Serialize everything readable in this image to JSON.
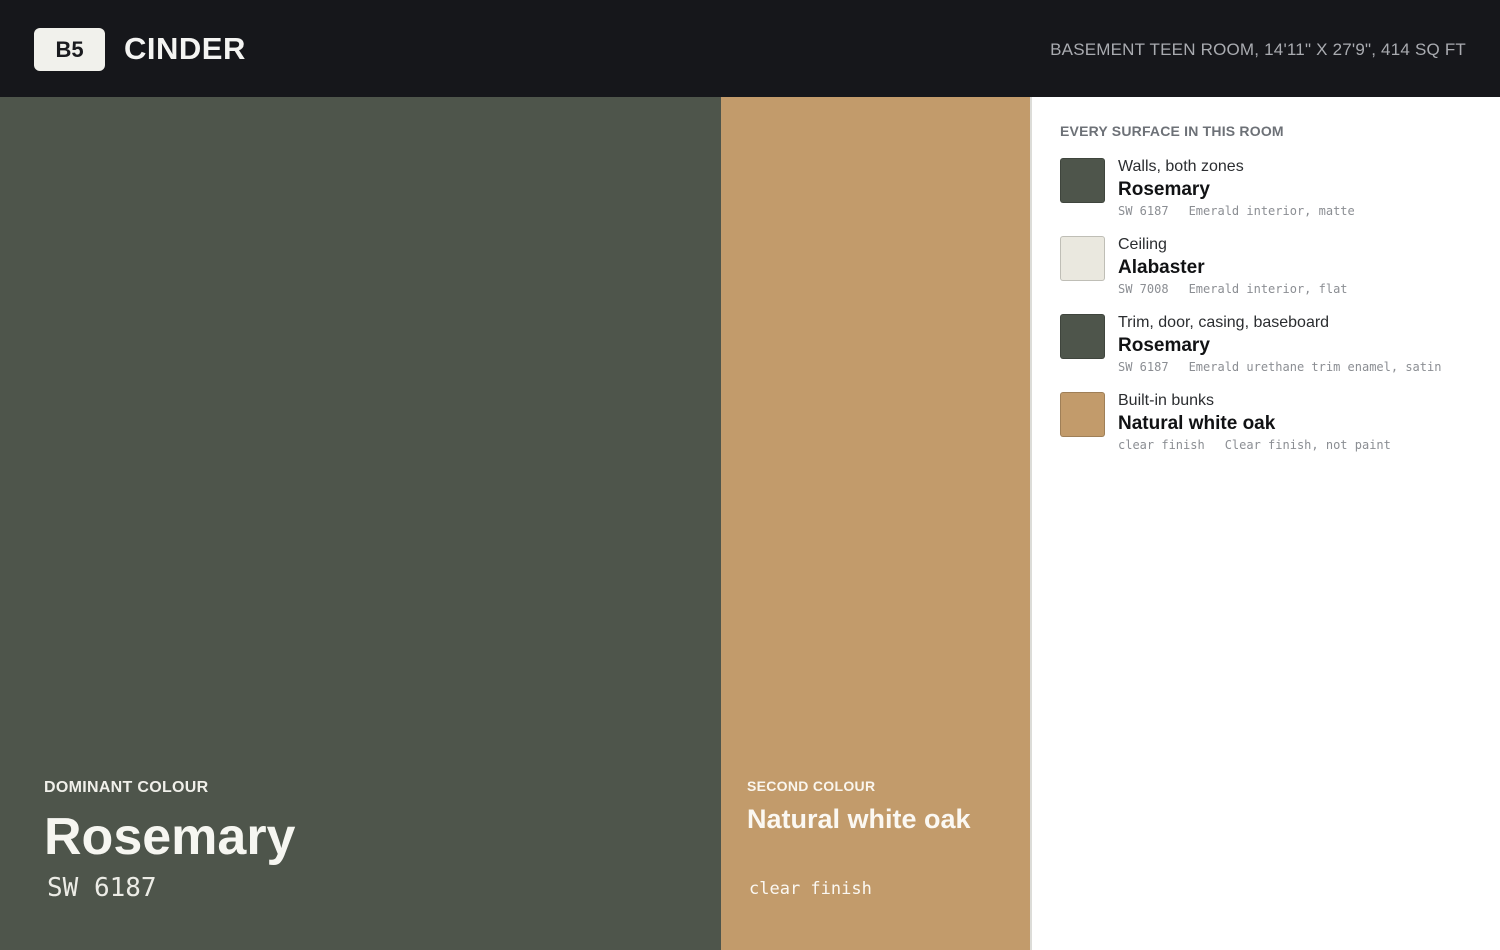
{
  "header": {
    "badge": "B5",
    "title": "CINDER",
    "room_info": "BASEMENT TEEN ROOM, 14'11\" X 27'9\", 414 SQ FT"
  },
  "dominant": {
    "kicker": "DOMINANT COLOUR",
    "name": "Rosemary",
    "code": "SW 6187",
    "color": "#4e554b"
  },
  "second": {
    "kicker": "SECOND COLOUR",
    "name": "Natural white oak",
    "code": "clear finish",
    "color": "#c29b6b"
  },
  "surfaces": {
    "title": "EVERY SURFACE IN THIS ROOM",
    "items": [
      {
        "label": "Walls, both zones",
        "color_name": "Rosemary",
        "code": "SW 6187",
        "finish": "Emerald interior, matte",
        "swatch": "#4e554b"
      },
      {
        "label": "Ceiling",
        "color_name": "Alabaster",
        "code": "SW 7008",
        "finish": "Emerald interior, flat",
        "swatch": "#eae8df"
      },
      {
        "label": "Trim, door, casing, baseboard",
        "color_name": "Rosemary",
        "code": "SW 6187",
        "finish": "Emerald urethane trim enamel, satin",
        "swatch": "#4e554b"
      },
      {
        "label": "Built-in bunks",
        "color_name": "Natural white oak",
        "code": "clear finish",
        "finish": "Clear finish, not paint",
        "swatch": "#c29b6b"
      }
    ]
  }
}
